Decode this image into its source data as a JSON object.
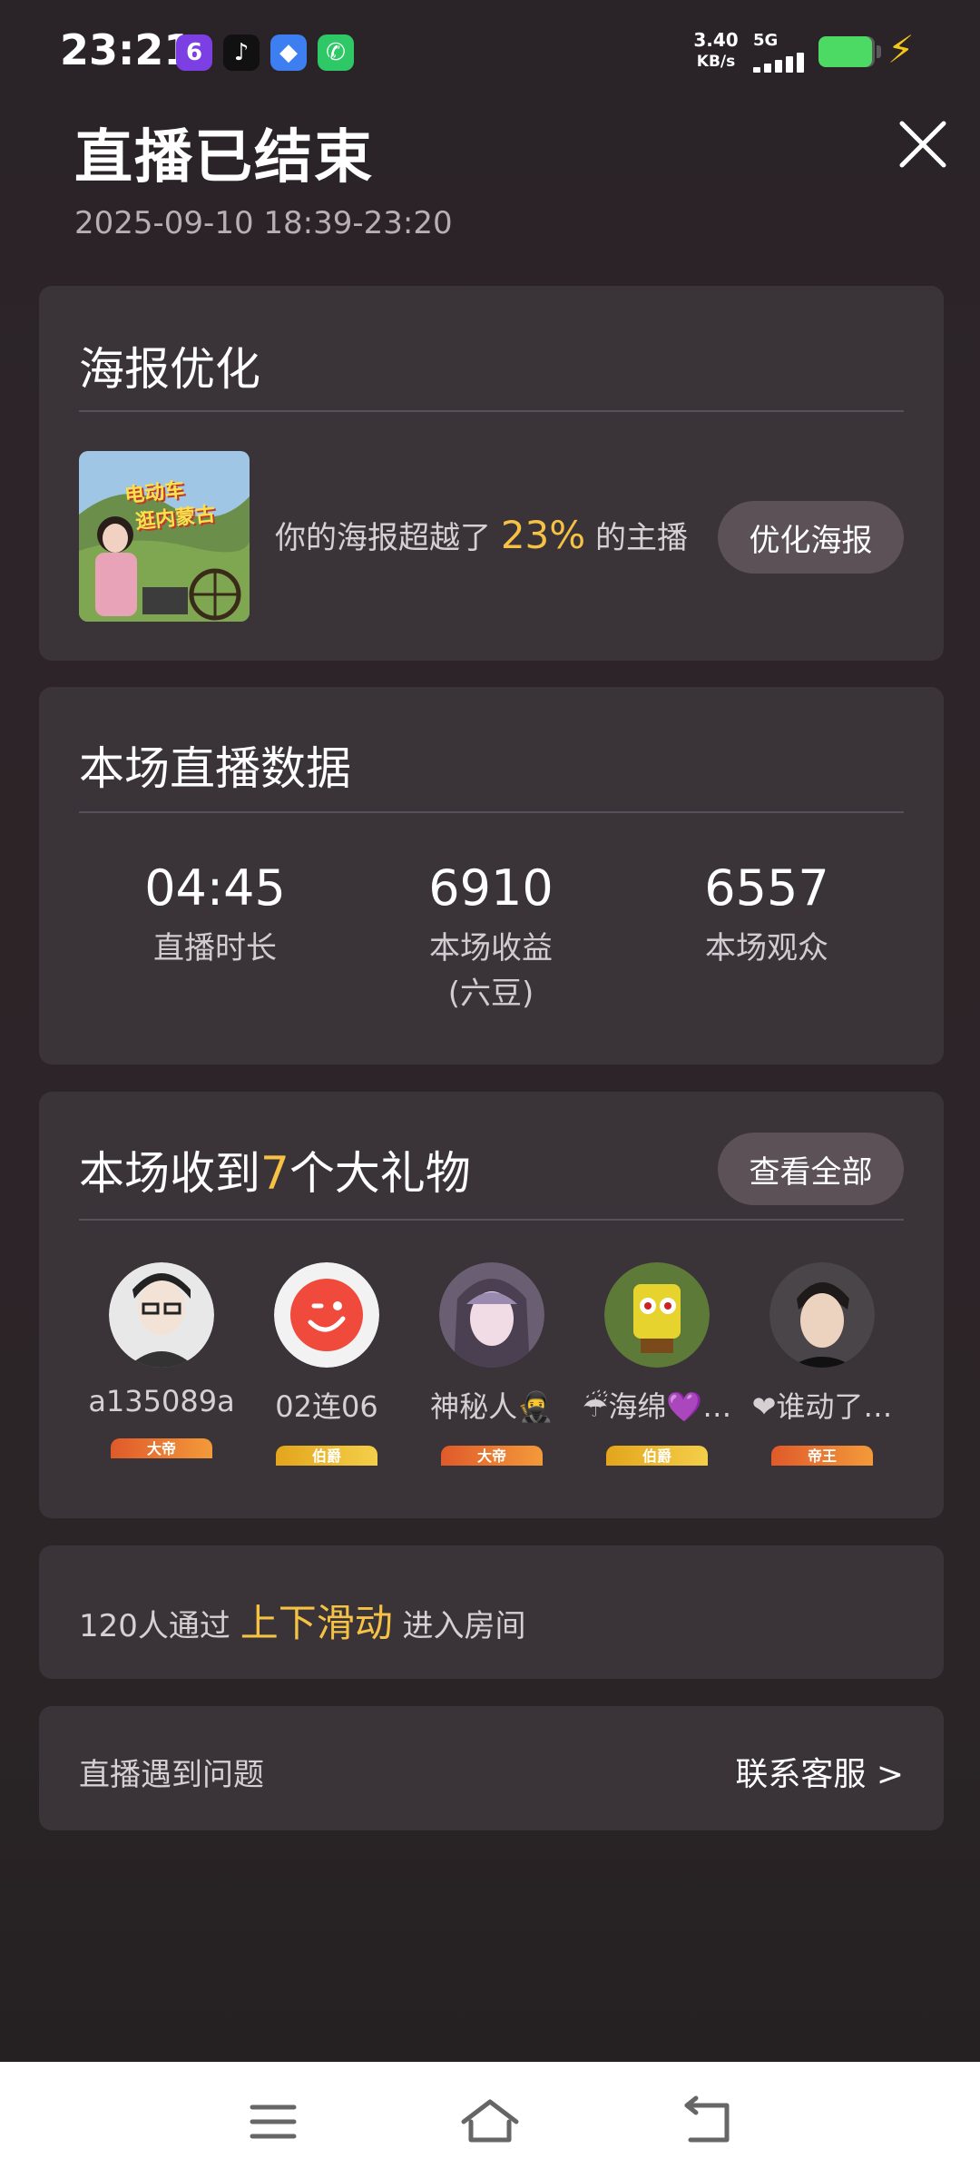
{
  "status": {
    "time": "23:21",
    "net_speed": "3.40",
    "net_unit": "KB/s",
    "network": "5G",
    "battery_pct": 0.95,
    "apps": [
      {
        "name": "six-rooms-icon",
        "glyph": "6",
        "color": "#7b3fe4"
      },
      {
        "name": "tiktok-icon",
        "glyph": "♪",
        "color": "#111111"
      },
      {
        "name": "chat-app-icon",
        "glyph": "◆",
        "color": "#3d7ef0"
      },
      {
        "name": "phone-icon",
        "glyph": "✆",
        "color": "#2ec866"
      }
    ]
  },
  "header": {
    "title": "直播已结束",
    "time_range": "2025-09-10 18:39-23:20"
  },
  "poster": {
    "title": "海报优化",
    "text_before": "你的海报超越了",
    "percent": "23%",
    "text_after": "的主播",
    "button": "优化海报",
    "thumb_line1": "电动车",
    "thumb_line2": "逛内蒙古"
  },
  "stats": {
    "title": "本场直播数据",
    "items": [
      {
        "value": "04:45",
        "label": "直播时长",
        "sub": ""
      },
      {
        "value": "6910",
        "label": "本场收益",
        "sub": "(六豆)"
      },
      {
        "value": "6557",
        "label": "本场观众",
        "sub": ""
      }
    ]
  },
  "gifts": {
    "title_before": "本场收到",
    "count": "7",
    "title_after": "个大礼物",
    "button": "查看全部",
    "gifters": [
      {
        "name": "a135089a",
        "badge": "大帝",
        "gold": false,
        "bg": "#e8e8e8"
      },
      {
        "name": "02连06",
        "badge": "伯爵",
        "gold": true,
        "bg": "#f0f0f0"
      },
      {
        "name": "神秘人🥷",
        "badge": "大帝",
        "gold": false,
        "bg": "#6a5e72"
      },
      {
        "name": "☔海绵💜…",
        "badge": "伯爵",
        "gold": true,
        "bg": "#7a8a3a"
      },
      {
        "name": "❤谁动了…",
        "badge": "帝王",
        "gold": false,
        "bg": "#4a4548"
      }
    ]
  },
  "swipe": {
    "text_before": "120人通过",
    "highlight": "上下滑动",
    "text_after": "进入房间"
  },
  "problem": {
    "text": "直播遇到问题",
    "link": "联系客服 >"
  }
}
